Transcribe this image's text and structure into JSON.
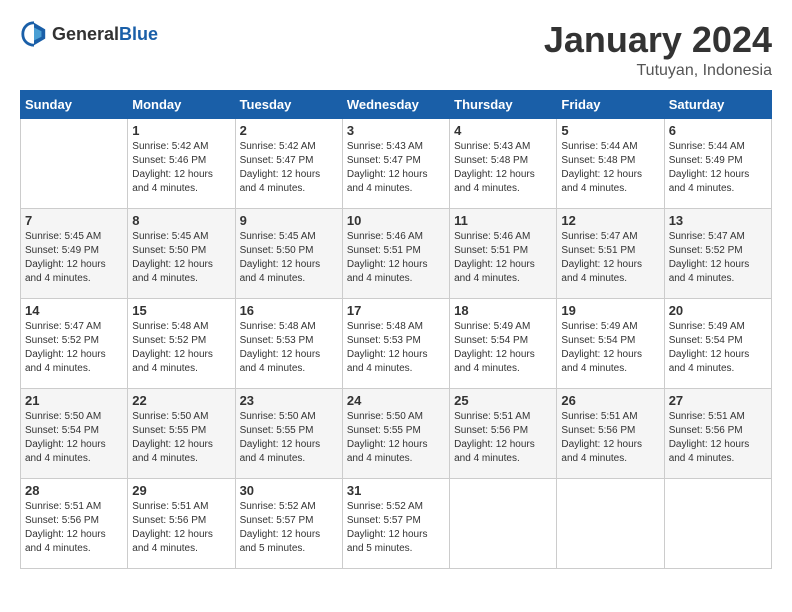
{
  "header": {
    "logo_general": "General",
    "logo_blue": "Blue",
    "month": "January 2024",
    "location": "Tutuyan, Indonesia"
  },
  "days_of_week": [
    "Sunday",
    "Monday",
    "Tuesday",
    "Wednesday",
    "Thursday",
    "Friday",
    "Saturday"
  ],
  "weeks": [
    [
      {
        "day": "",
        "sunrise": "",
        "sunset": "",
        "daylight": ""
      },
      {
        "day": "1",
        "sunrise": "Sunrise: 5:42 AM",
        "sunset": "Sunset: 5:46 PM",
        "daylight": "Daylight: 12 hours and 4 minutes."
      },
      {
        "day": "2",
        "sunrise": "Sunrise: 5:42 AM",
        "sunset": "Sunset: 5:47 PM",
        "daylight": "Daylight: 12 hours and 4 minutes."
      },
      {
        "day": "3",
        "sunrise": "Sunrise: 5:43 AM",
        "sunset": "Sunset: 5:47 PM",
        "daylight": "Daylight: 12 hours and 4 minutes."
      },
      {
        "day": "4",
        "sunrise": "Sunrise: 5:43 AM",
        "sunset": "Sunset: 5:48 PM",
        "daylight": "Daylight: 12 hours and 4 minutes."
      },
      {
        "day": "5",
        "sunrise": "Sunrise: 5:44 AM",
        "sunset": "Sunset: 5:48 PM",
        "daylight": "Daylight: 12 hours and 4 minutes."
      },
      {
        "day": "6",
        "sunrise": "Sunrise: 5:44 AM",
        "sunset": "Sunset: 5:49 PM",
        "daylight": "Daylight: 12 hours and 4 minutes."
      }
    ],
    [
      {
        "day": "7",
        "sunrise": "Sunrise: 5:45 AM",
        "sunset": "Sunset: 5:49 PM",
        "daylight": "Daylight: 12 hours and 4 minutes."
      },
      {
        "day": "8",
        "sunrise": "Sunrise: 5:45 AM",
        "sunset": "Sunset: 5:50 PM",
        "daylight": "Daylight: 12 hours and 4 minutes."
      },
      {
        "day": "9",
        "sunrise": "Sunrise: 5:45 AM",
        "sunset": "Sunset: 5:50 PM",
        "daylight": "Daylight: 12 hours and 4 minutes."
      },
      {
        "day": "10",
        "sunrise": "Sunrise: 5:46 AM",
        "sunset": "Sunset: 5:51 PM",
        "daylight": "Daylight: 12 hours and 4 minutes."
      },
      {
        "day": "11",
        "sunrise": "Sunrise: 5:46 AM",
        "sunset": "Sunset: 5:51 PM",
        "daylight": "Daylight: 12 hours and 4 minutes."
      },
      {
        "day": "12",
        "sunrise": "Sunrise: 5:47 AM",
        "sunset": "Sunset: 5:51 PM",
        "daylight": "Daylight: 12 hours and 4 minutes."
      },
      {
        "day": "13",
        "sunrise": "Sunrise: 5:47 AM",
        "sunset": "Sunset: 5:52 PM",
        "daylight": "Daylight: 12 hours and 4 minutes."
      }
    ],
    [
      {
        "day": "14",
        "sunrise": "Sunrise: 5:47 AM",
        "sunset": "Sunset: 5:52 PM",
        "daylight": "Daylight: 12 hours and 4 minutes."
      },
      {
        "day": "15",
        "sunrise": "Sunrise: 5:48 AM",
        "sunset": "Sunset: 5:52 PM",
        "daylight": "Daylight: 12 hours and 4 minutes."
      },
      {
        "day": "16",
        "sunrise": "Sunrise: 5:48 AM",
        "sunset": "Sunset: 5:53 PM",
        "daylight": "Daylight: 12 hours and 4 minutes."
      },
      {
        "day": "17",
        "sunrise": "Sunrise: 5:48 AM",
        "sunset": "Sunset: 5:53 PM",
        "daylight": "Daylight: 12 hours and 4 minutes."
      },
      {
        "day": "18",
        "sunrise": "Sunrise: 5:49 AM",
        "sunset": "Sunset: 5:54 PM",
        "daylight": "Daylight: 12 hours and 4 minutes."
      },
      {
        "day": "19",
        "sunrise": "Sunrise: 5:49 AM",
        "sunset": "Sunset: 5:54 PM",
        "daylight": "Daylight: 12 hours and 4 minutes."
      },
      {
        "day": "20",
        "sunrise": "Sunrise: 5:49 AM",
        "sunset": "Sunset: 5:54 PM",
        "daylight": "Daylight: 12 hours and 4 minutes."
      }
    ],
    [
      {
        "day": "21",
        "sunrise": "Sunrise: 5:50 AM",
        "sunset": "Sunset: 5:54 PM",
        "daylight": "Daylight: 12 hours and 4 minutes."
      },
      {
        "day": "22",
        "sunrise": "Sunrise: 5:50 AM",
        "sunset": "Sunset: 5:55 PM",
        "daylight": "Daylight: 12 hours and 4 minutes."
      },
      {
        "day": "23",
        "sunrise": "Sunrise: 5:50 AM",
        "sunset": "Sunset: 5:55 PM",
        "daylight": "Daylight: 12 hours and 4 minutes."
      },
      {
        "day": "24",
        "sunrise": "Sunrise: 5:50 AM",
        "sunset": "Sunset: 5:55 PM",
        "daylight": "Daylight: 12 hours and 4 minutes."
      },
      {
        "day": "25",
        "sunrise": "Sunrise: 5:51 AM",
        "sunset": "Sunset: 5:56 PM",
        "daylight": "Daylight: 12 hours and 4 minutes."
      },
      {
        "day": "26",
        "sunrise": "Sunrise: 5:51 AM",
        "sunset": "Sunset: 5:56 PM",
        "daylight": "Daylight: 12 hours and 4 minutes."
      },
      {
        "day": "27",
        "sunrise": "Sunrise: 5:51 AM",
        "sunset": "Sunset: 5:56 PM",
        "daylight": "Daylight: 12 hours and 4 minutes."
      }
    ],
    [
      {
        "day": "28",
        "sunrise": "Sunrise: 5:51 AM",
        "sunset": "Sunset: 5:56 PM",
        "daylight": "Daylight: 12 hours and 4 minutes."
      },
      {
        "day": "29",
        "sunrise": "Sunrise: 5:51 AM",
        "sunset": "Sunset: 5:56 PM",
        "daylight": "Daylight: 12 hours and 4 minutes."
      },
      {
        "day": "30",
        "sunrise": "Sunrise: 5:52 AM",
        "sunset": "Sunset: 5:57 PM",
        "daylight": "Daylight: 12 hours and 5 minutes."
      },
      {
        "day": "31",
        "sunrise": "Sunrise: 5:52 AM",
        "sunset": "Sunset: 5:57 PM",
        "daylight": "Daylight: 12 hours and 5 minutes."
      },
      {
        "day": "",
        "sunrise": "",
        "sunset": "",
        "daylight": ""
      },
      {
        "day": "",
        "sunrise": "",
        "sunset": "",
        "daylight": ""
      },
      {
        "day": "",
        "sunrise": "",
        "sunset": "",
        "daylight": ""
      }
    ]
  ]
}
